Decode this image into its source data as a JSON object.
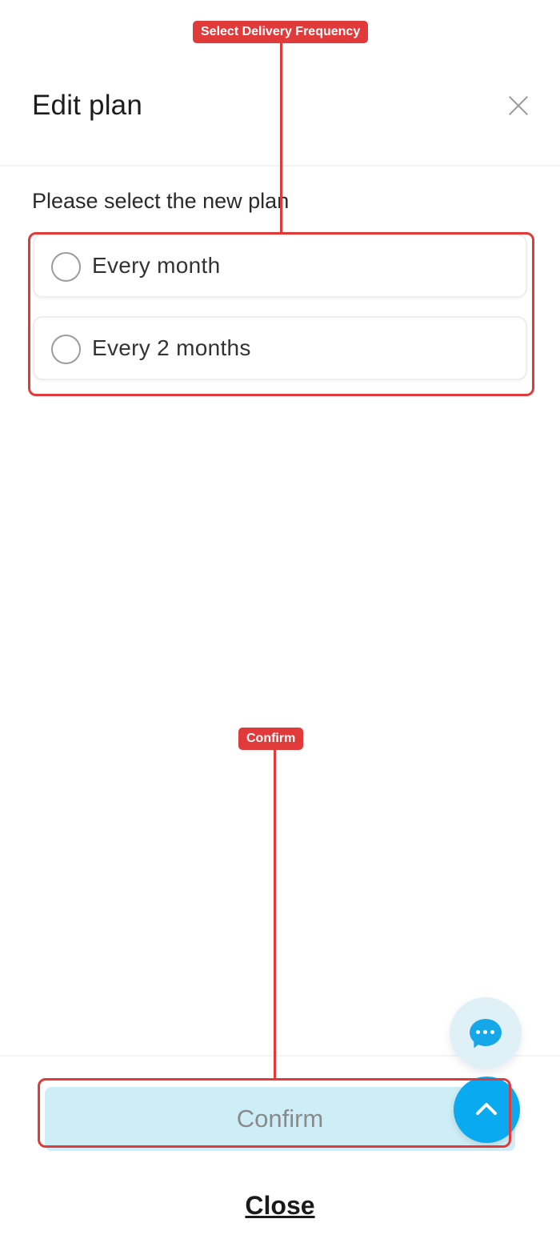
{
  "modal": {
    "title": "Edit plan",
    "prompt": "Please select the new plan",
    "options": [
      {
        "label": "Every month",
        "selected": false
      },
      {
        "label": "Every 2 months",
        "selected": false
      }
    ],
    "confirm_label": "Confirm",
    "close_label": "Close"
  },
  "icons": {
    "close": "close-icon",
    "chat": "chat-bubble-icon",
    "scroll_up": "chevron-up-icon"
  },
  "colors": {
    "confirm_bg": "#cdeef6",
    "fab_blue": "#0aaaf0",
    "annotation_red": "#e03a3a"
  },
  "annotations": [
    {
      "label": "Select Delivery Frequency"
    },
    {
      "label": "Confirm"
    }
  ]
}
